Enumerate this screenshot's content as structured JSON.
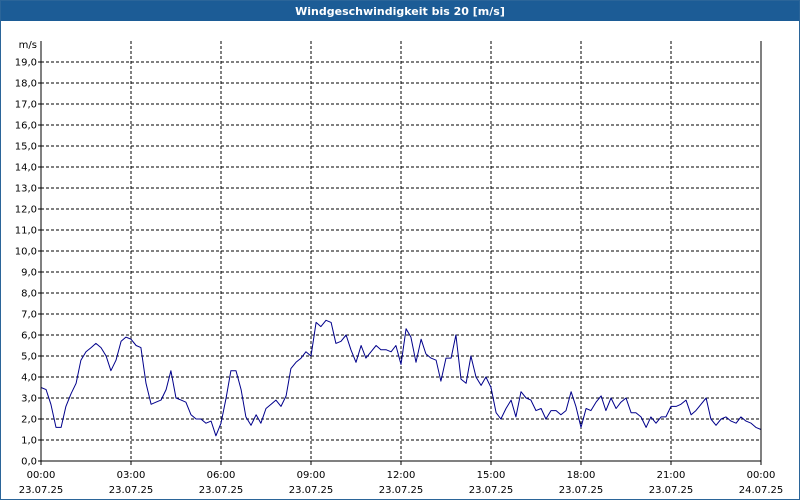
{
  "window": {
    "title": "Windgeschwindigkeit bis 20 [m/s]"
  },
  "chart_data": {
    "type": "line",
    "title": "Windgeschwindigkeit bis 20 [m/s]",
    "ylabel": "m/s",
    "xlabel": "",
    "ylim": [
      0,
      20
    ],
    "xlim_hours": [
      0,
      24
    ],
    "grid": true,
    "colors": {
      "line": "#00008b",
      "grid": "#000000",
      "background": "#ffffff",
      "title_bar": "#1c5c96"
    },
    "y_ticks": [
      "0,0",
      "1,0",
      "2,0",
      "3,0",
      "4,0",
      "5,0",
      "6,0",
      "7,0",
      "8,0",
      "9,0",
      "10,0",
      "11,0",
      "12,0",
      "13,0",
      "14,0",
      "15,0",
      "16,0",
      "17,0",
      "18,0",
      "19,0"
    ],
    "x_ticks": [
      {
        "hour": 0,
        "time": "00:00",
        "date": "23.07.25"
      },
      {
        "hour": 3,
        "time": "03:00",
        "date": "23.07.25"
      },
      {
        "hour": 6,
        "time": "06:00",
        "date": "23.07.25"
      },
      {
        "hour": 9,
        "time": "09:00",
        "date": "23.07.25"
      },
      {
        "hour": 12,
        "time": "12:00",
        "date": "23.07.25"
      },
      {
        "hour": 15,
        "time": "15:00",
        "date": "23.07.25"
      },
      {
        "hour": 18,
        "time": "18:00",
        "date": "23.07.25"
      },
      {
        "hour": 21,
        "time": "21:00",
        "date": "23.07.25"
      },
      {
        "hour": 24,
        "time": "00:00",
        "date": "24.07.25"
      }
    ],
    "series": [
      {
        "x": [
          0.0,
          0.17,
          0.33,
          0.5,
          0.67,
          0.83,
          1.0,
          1.17,
          1.33,
          1.5,
          1.67,
          1.83,
          2.0,
          2.17,
          2.33,
          2.5,
          2.67,
          2.83,
          3.0,
          3.17,
          3.33,
          3.5,
          3.67,
          3.83,
          4.0,
          4.17,
          4.33,
          4.5,
          4.67,
          4.83,
          5.0,
          5.17,
          5.33,
          5.5,
          5.67,
          5.83,
          6.0,
          6.17,
          6.33,
          6.5,
          6.67,
          6.83,
          7.0,
          7.17,
          7.33,
          7.5,
          7.67,
          7.83,
          8.0,
          8.17,
          8.33,
          8.5,
          8.67,
          8.83,
          9.0,
          9.17,
          9.33,
          9.5,
          9.67,
          9.83,
          10.0,
          10.17,
          10.33,
          10.5,
          10.67,
          10.83,
          11.0,
          11.17,
          11.33,
          11.5,
          11.67,
          11.83,
          12.0,
          12.17,
          12.33,
          12.5,
          12.67,
          12.83,
          13.0,
          13.17,
          13.33,
          13.5,
          13.67,
          13.83,
          14.0,
          14.17,
          14.33,
          14.5,
          14.67,
          14.83,
          15.0,
          15.17,
          15.33,
          15.5,
          15.67,
          15.83,
          16.0,
          16.17,
          16.33,
          16.5,
          16.67,
          16.83,
          17.0,
          17.17,
          17.33,
          17.5,
          17.67,
          17.83,
          18.0,
          18.17,
          18.33,
          18.5,
          18.67,
          18.83,
          19.0,
          19.17,
          19.33,
          19.5,
          19.67,
          19.83,
          20.0,
          20.17,
          20.33,
          20.5,
          20.67,
          20.83,
          21.0,
          21.17,
          21.33,
          21.5,
          21.67,
          21.83,
          22.0,
          22.17,
          22.33,
          22.5,
          22.67,
          22.83,
          23.0,
          23.17,
          23.33,
          23.5,
          23.67,
          23.83,
          24.0
        ],
        "values": [
          3.5,
          3.4,
          2.7,
          1.6,
          1.6,
          2.6,
          3.2,
          3.7,
          4.8,
          5.2,
          5.4,
          5.6,
          5.4,
          5.0,
          4.3,
          4.8,
          5.7,
          5.9,
          5.8,
          5.5,
          5.4,
          3.7,
          2.7,
          2.8,
          2.9,
          3.4,
          4.3,
          3.0,
          2.9,
          2.8,
          2.2,
          2.0,
          2.0,
          1.8,
          1.9,
          1.2,
          1.8,
          3.0,
          4.3,
          4.3,
          3.4,
          2.1,
          1.7,
          2.2,
          1.8,
          2.5,
          2.7,
          2.9,
          2.6,
          3.1,
          4.4,
          4.7,
          4.9,
          5.2,
          5.0,
          6.6,
          6.4,
          6.7,
          6.6,
          5.6,
          5.7,
          6.0,
          5.3,
          4.7,
          5.5,
          4.9,
          5.2,
          5.5,
          5.3,
          5.3,
          5.2,
          5.5,
          4.6,
          6.3,
          5.9,
          4.7,
          5.8,
          5.1,
          4.9,
          4.8,
          3.8,
          4.9,
          4.9,
          6.0,
          3.9,
          3.7,
          5.0,
          4.0,
          3.6,
          4.0,
          3.5,
          2.3,
          2.0,
          2.5,
          2.9,
          2.1,
          3.3,
          3.0,
          2.9,
          2.4,
          2.5,
          2.0,
          2.4,
          2.4,
          2.2,
          2.4,
          3.3,
          2.6,
          1.6,
          2.5,
          2.4,
          2.8,
          3.1,
          2.4,
          3.0,
          2.5,
          2.8,
          3.0,
          2.3,
          2.3,
          2.1,
          1.6,
          2.1,
          1.8,
          2.1,
          2.1,
          2.6,
          2.6,
          2.7,
          2.9,
          2.2,
          2.4,
          2.7,
          3.0,
          2.0,
          1.7,
          2.0,
          2.1,
          1.9,
          1.8,
          2.1,
          1.9,
          1.8,
          1.6,
          1.5
        ]
      }
    ]
  }
}
